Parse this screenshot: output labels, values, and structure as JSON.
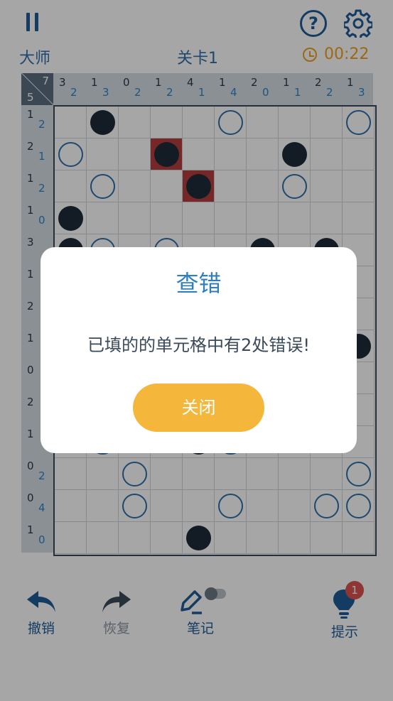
{
  "header": {
    "difficulty": "大师",
    "level": "关卡1",
    "timer": "00:22"
  },
  "corner": {
    "top": "7",
    "bottom": "5"
  },
  "columns": [
    {
      "n": "3",
      "b": "2"
    },
    {
      "n": "1",
      "b": "3"
    },
    {
      "n": "0",
      "b": "2"
    },
    {
      "n": "1",
      "b": "2"
    },
    {
      "n": "4",
      "b": "1"
    },
    {
      "n": "1",
      "b": "4"
    },
    {
      "n": "2",
      "b": "0"
    },
    {
      "n": "1",
      "b": "1"
    },
    {
      "n": "2",
      "b": "2"
    },
    {
      "n": "1",
      "b": "3"
    }
  ],
  "rows": [
    {
      "n": "1",
      "b": "2"
    },
    {
      "n": "2",
      "b": "1"
    },
    {
      "n": "1",
      "b": "2"
    },
    {
      "n": "1",
      "b": "0"
    },
    {
      "n": "3",
      "b": ""
    },
    {
      "n": "1",
      "b": ""
    },
    {
      "n": "2",
      "b": ""
    },
    {
      "n": "1",
      "b": ""
    },
    {
      "n": "0",
      "b": ""
    },
    {
      "n": "2",
      "b": ""
    },
    {
      "n": "1",
      "b": ""
    },
    {
      "n": "0",
      "b": "2"
    },
    {
      "n": "0",
      "b": "4"
    },
    {
      "n": "1",
      "b": "0"
    }
  ],
  "grid": [
    "-B---W---W",
    "W--X---B--",
    "-W--X--W--",
    "B---------",
    "BW-W--B-B-",
    "----------",
    "----------",
    "---------B",
    "----------",
    "----------",
    "-W--BW----",
    "--W------W",
    "--W--W--WW",
    "----B-----"
  ],
  "dialog": {
    "title": "查错",
    "message": "已填的的单元格中有2处错误!",
    "close_label": "关闭"
  },
  "toolbar": {
    "undo": "撤销",
    "redo": "恢复",
    "notes": "笔记",
    "hint": "提示",
    "hint_count": "1"
  },
  "colors": {
    "accent": "#2e6fa8",
    "button": "#f5b63c",
    "error": "#b63c3c",
    "timer": "#f0a020"
  }
}
